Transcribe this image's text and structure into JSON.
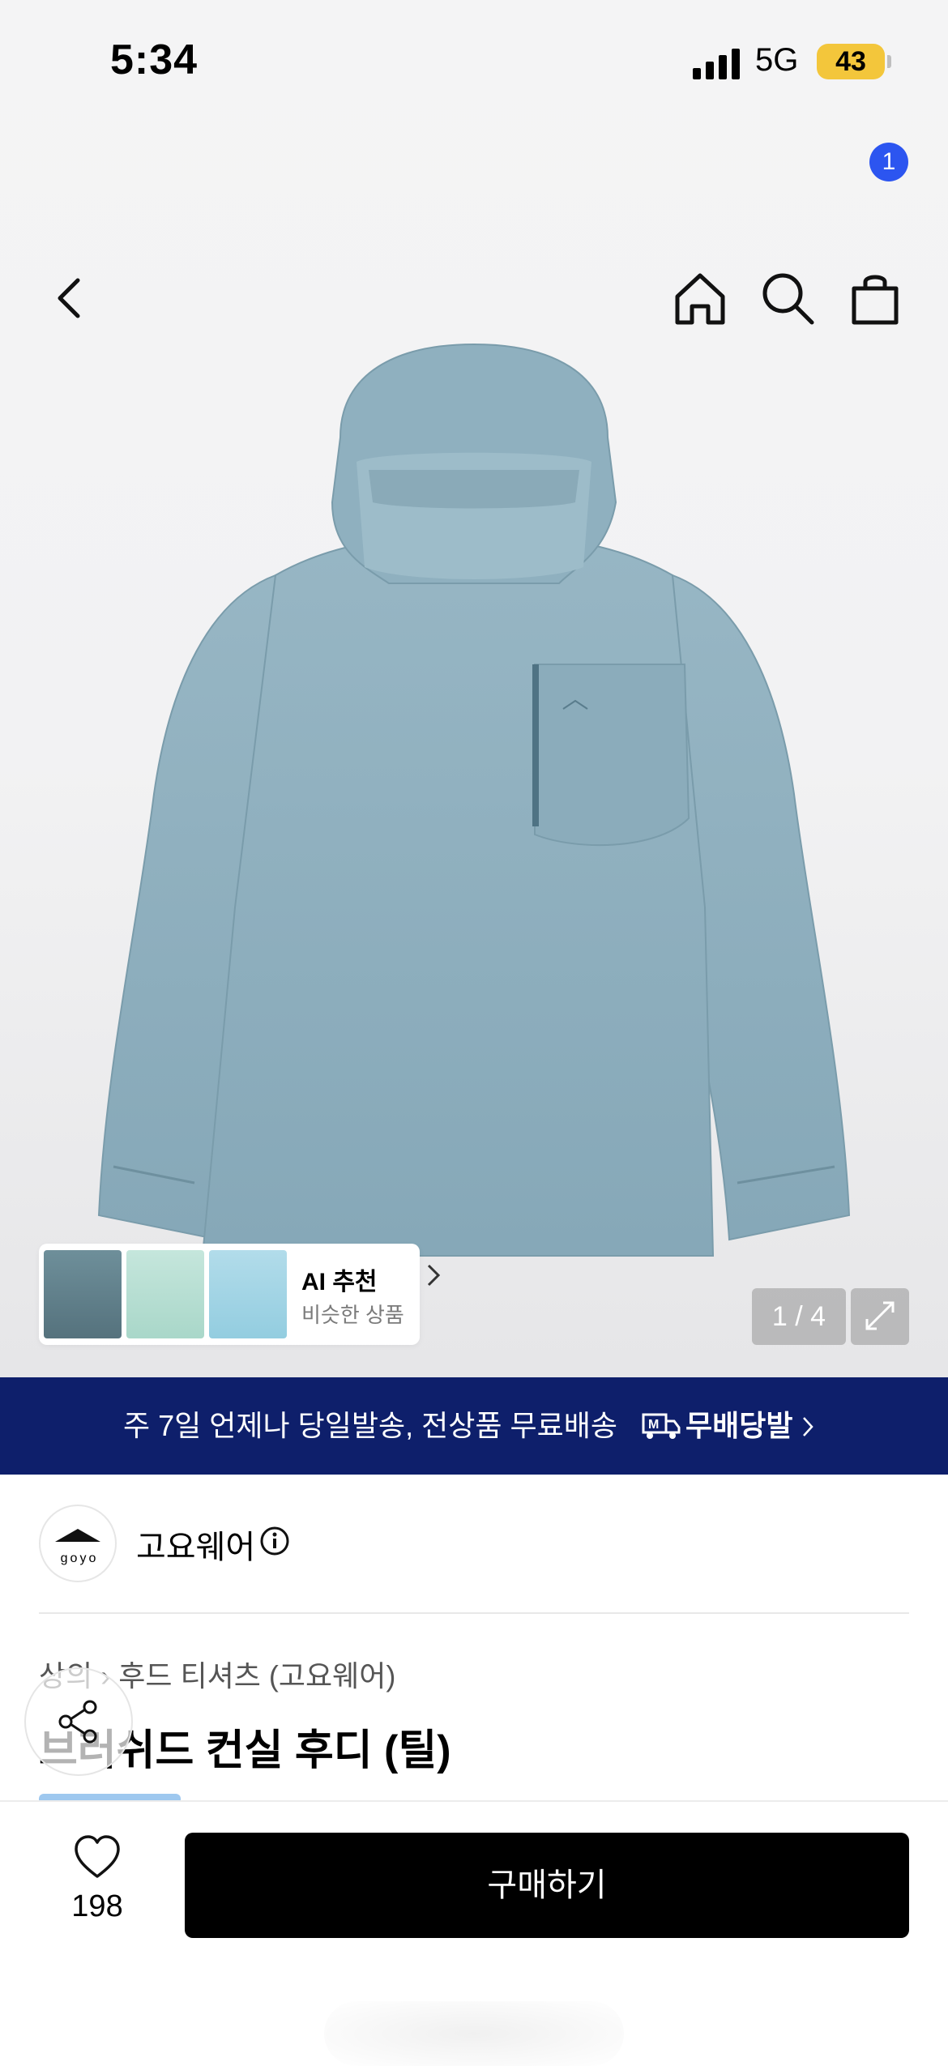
{
  "status_bar": {
    "time": "5:34",
    "network": "5G",
    "battery": "43"
  },
  "nav": {
    "cart_count": "1"
  },
  "gallery": {
    "counter": "1 / 4"
  },
  "ai_recommend": {
    "title": "AI 추천",
    "subtitle": "비슷한 상품"
  },
  "promo": {
    "text": "주 7일 언제나 당일발송, 전상품 무료배송",
    "brand": "무배당발"
  },
  "brand": {
    "name": "고요웨어",
    "logo_text": "goyo"
  },
  "product": {
    "breadcrumb_parent": "상의",
    "breadcrumb_current": "후드 티셔츠 (고요웨어)",
    "title": "브러쉬드 컨실 후디 (틸)"
  },
  "bottom_bar": {
    "like_count": "198",
    "buy_label": "구매하기"
  },
  "colors": {
    "promo_bg": "#0e1f6b",
    "badge": "#2c55f0",
    "product": "#8fb0bf"
  }
}
